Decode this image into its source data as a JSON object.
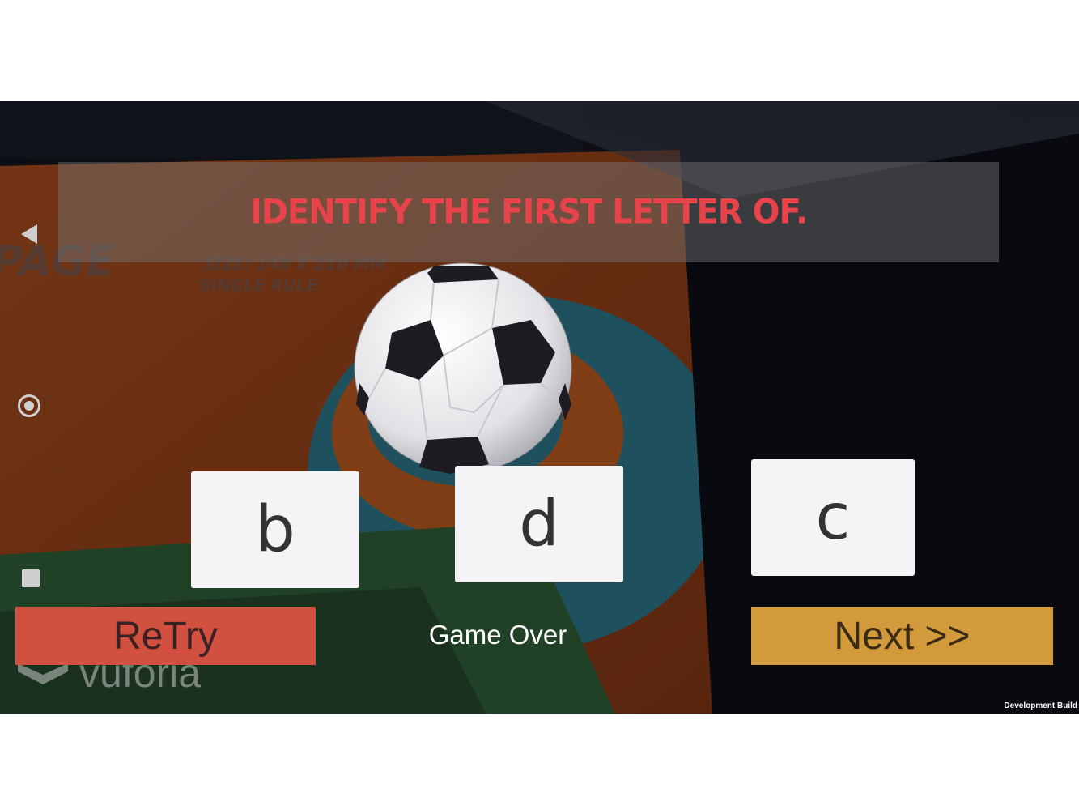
{
  "banner": {
    "text": "IDENTIFY THE FIRST LETTER OF."
  },
  "choices": [
    {
      "label": "b"
    },
    {
      "label": "d"
    },
    {
      "label": "c"
    }
  ],
  "retry_label": "ReTry",
  "next_label": "Next >>",
  "status_text": "Game Over",
  "watermark_text": "vuforia",
  "dev_build_text": "Development Build",
  "background_print": {
    "line1": "PAGE",
    "line2": "SIZE: 148 X 210 MM",
    "line3": "SINGLE RULE"
  },
  "colors": {
    "banner_text": "#e8424a",
    "retry": "#d1503f",
    "next": "#d29a3a"
  },
  "icons": {
    "nav_back": "triangle-left",
    "nav_home": "circle",
    "nav_recent": "square",
    "ball": "soccer-ball",
    "watermark_logo": "vuforia-logo"
  }
}
